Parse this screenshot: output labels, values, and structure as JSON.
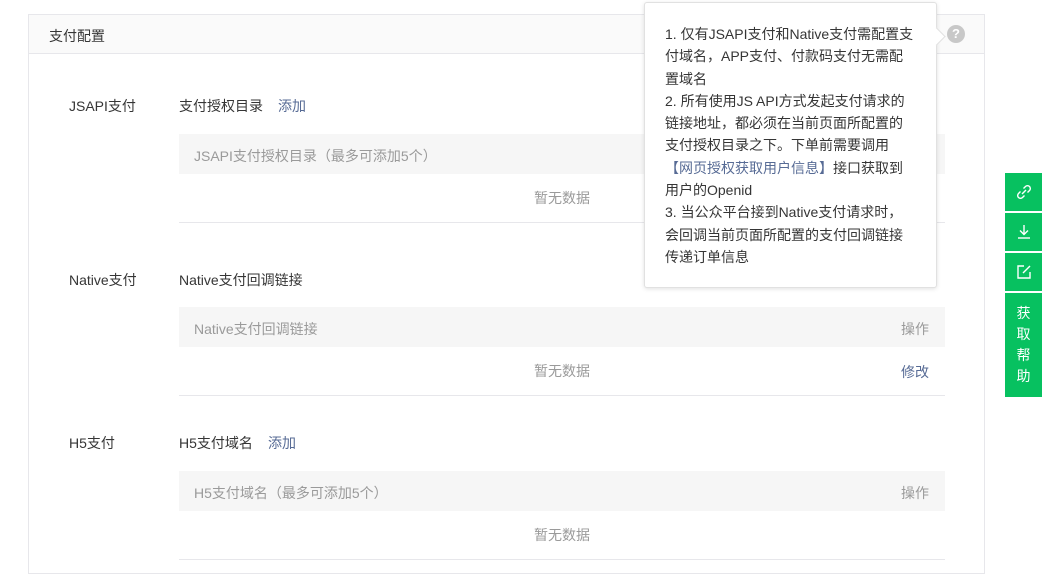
{
  "panel": {
    "title": "支付配置",
    "help_glyph": "?"
  },
  "jsapi": {
    "label": "JSAPI支付",
    "sub_title": "支付授权目录",
    "add_link": "添加",
    "col_header": "JSAPI支付授权目录（最多可添加5个）",
    "empty": "暂无数据"
  },
  "native": {
    "label": "Native支付",
    "sub_title": "Native支付回调链接",
    "col_header": "Native支付回调链接",
    "col_action": "操作",
    "empty": "暂无数据",
    "edit_link": "修改"
  },
  "h5": {
    "label": "H5支付",
    "sub_title": "H5支付域名",
    "add_link": "添加",
    "col_header": "H5支付域名（最多可添加5个）",
    "col_action": "操作",
    "empty": "暂无数据"
  },
  "popover": {
    "item1": "1. 仅有JSAPI支付和Native支付需配置支付域名，APP支付、付款码支付无需配置域名",
    "item2_pre": "2. 所有使用JS API方式发起支付请求的链接地址，都必须在当前页面所配置的支付授权目录之下。下单前需要调用",
    "item2_link": "【网页授权获取用户信息】",
    "item2_post": "接口获取到用户的Openid",
    "item3": "3. 当公众平台接到Native支付请求时，会回调当前页面所配置的支付回调链接传递订单信息"
  },
  "sidebar": {
    "help_chars": [
      "获",
      "取",
      "帮",
      "助"
    ],
    "icons": [
      "link-icon",
      "download-icon",
      "edit-icon"
    ],
    "color": "#07c160"
  },
  "colors": {
    "link": "#576b95",
    "muted": "#9a9a9a"
  }
}
